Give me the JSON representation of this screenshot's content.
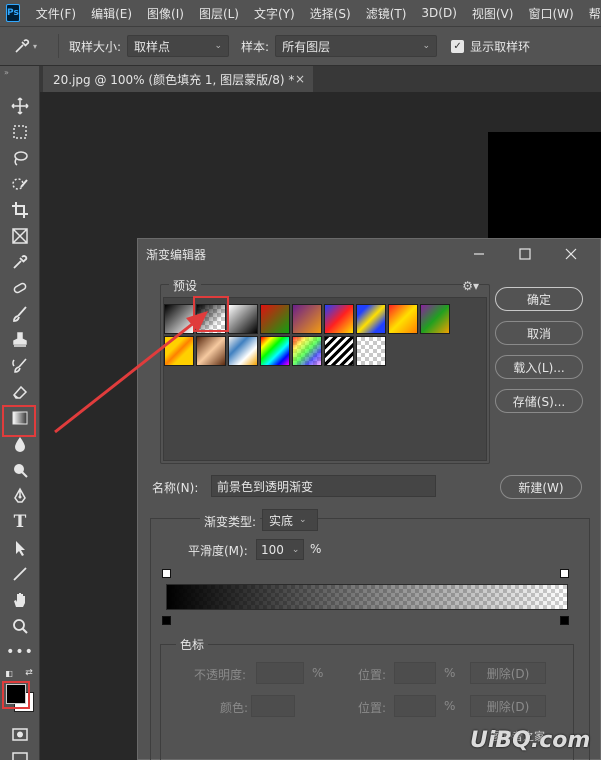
{
  "menubar": {
    "logo": "Ps",
    "items": [
      "文件(F)",
      "编辑(E)",
      "图像(I)",
      "图层(L)",
      "文字(Y)",
      "选择(S)",
      "滤镜(T)",
      "3D(D)",
      "视图(V)",
      "窗口(W)",
      "帮助"
    ]
  },
  "options": {
    "sample_size_label": "取样大小:",
    "sample_size_value": "取样点",
    "sample_label": "样本:",
    "sample_value": "所有图层",
    "show_ring_label": "显示取样环"
  },
  "document": {
    "tab_title": "20.jpg @ 100% (颜色填充 1, 图层蒙版/8) *",
    "close": "×"
  },
  "dialog": {
    "title": "渐变编辑器",
    "presets_label": "预设",
    "buttons": {
      "ok": "确定",
      "cancel": "取消",
      "load": "载入(L)...",
      "save": "存储(S)...",
      "new": "新建(W)"
    },
    "name_label": "名称(N):",
    "name_value": "前景色到透明渐变",
    "gradient_type_label": "渐变类型:",
    "gradient_type_value": "实底",
    "smoothness_label": "平滑度(M):",
    "smoothness_value": "100",
    "smoothness_unit": "%",
    "stops": {
      "label": "色标",
      "opacity_label": "不透明度:",
      "opacity_unit": "%",
      "position_label": "位置:",
      "position_unit": "%",
      "delete_label": "删除(D)",
      "color_label": "颜色:"
    }
  },
  "watermark": {
    "text": "UiBQ.com",
    "small": "图好者之家"
  },
  "colors": {
    "highlight": "#e03c3c",
    "ui_bg": "#535353",
    "canvas": "#282828"
  }
}
